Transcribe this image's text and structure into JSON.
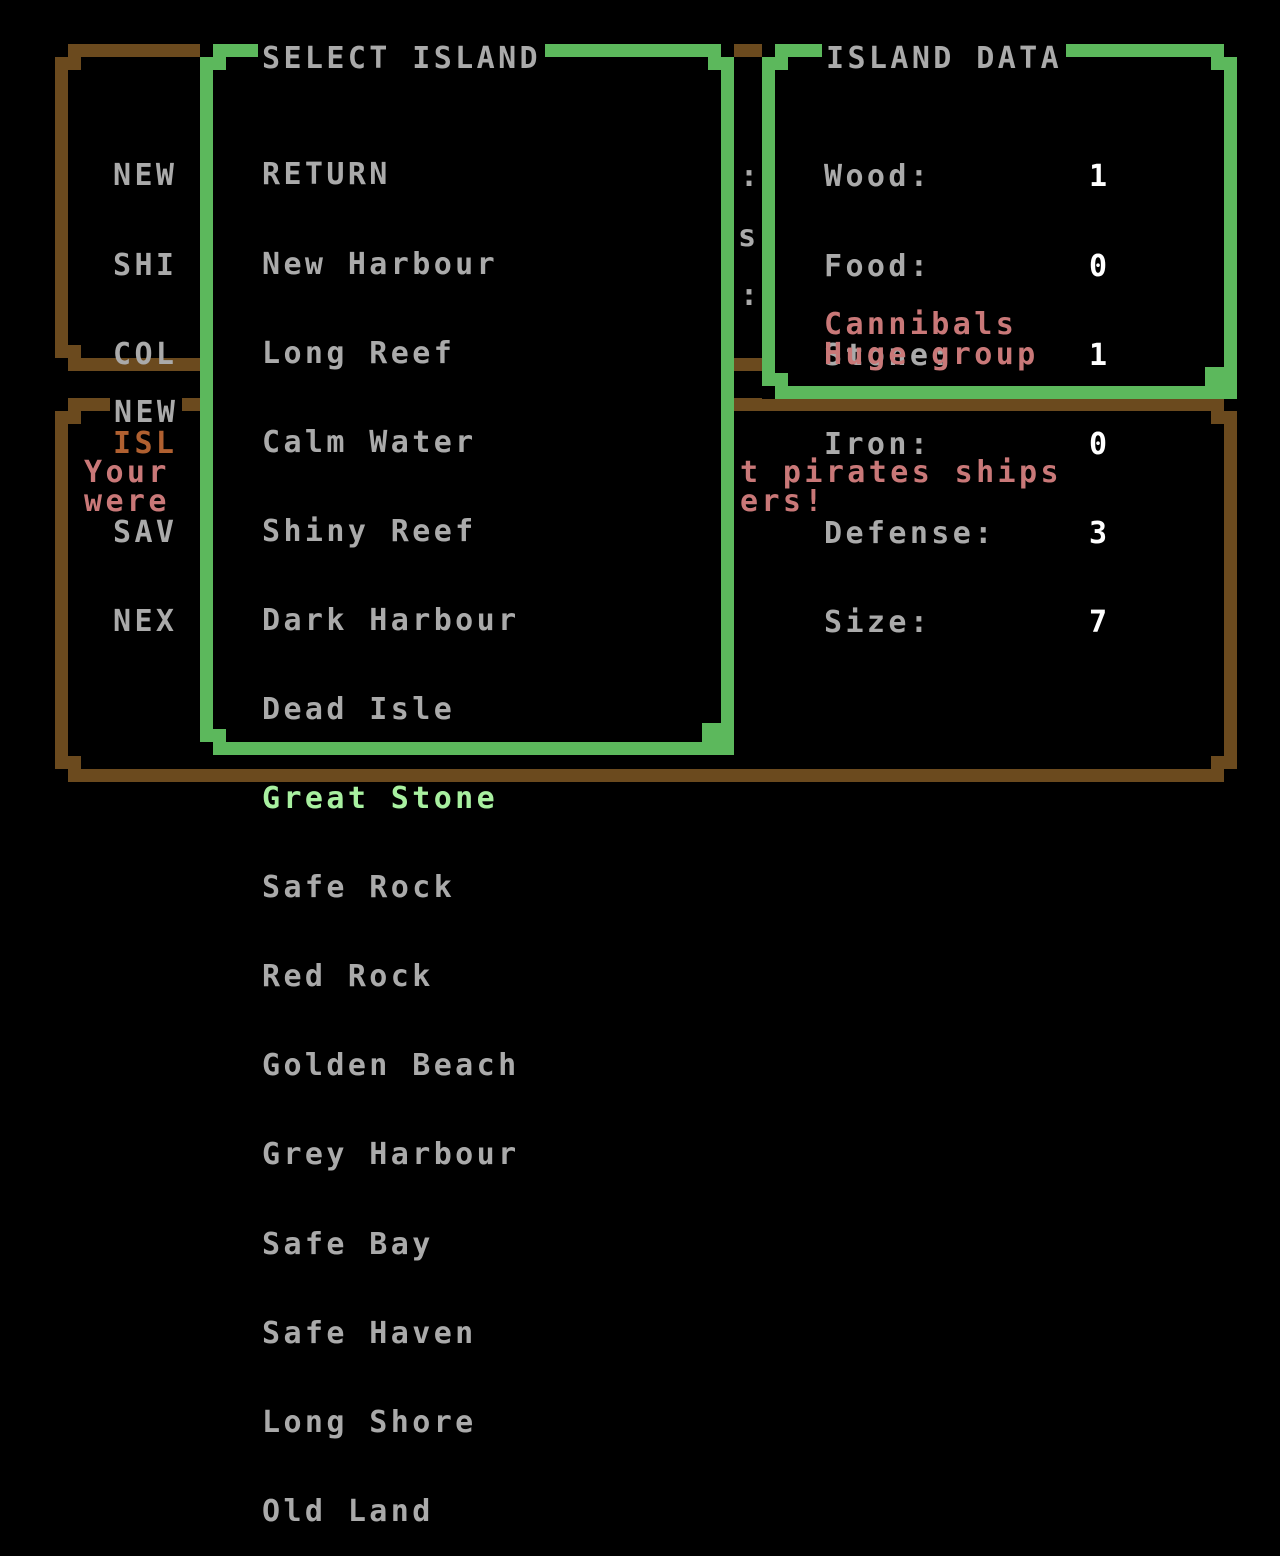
{
  "menu": {
    "items": [
      {
        "label": "NEW"
      },
      {
        "label": "SHI"
      },
      {
        "label": "COL"
      },
      {
        "label": "ISL"
      },
      {
        "label": "SAV"
      },
      {
        "label": "NEX"
      }
    ],
    "colon_fragments": [
      ":",
      "s",
      ":"
    ]
  },
  "news": {
    "title": "NEW",
    "line1_left": "Your",
    "line1_right": "t pirates ships",
    "line2_left": "were",
    "line2_right": "ers!"
  },
  "select_island": {
    "title": "SELECT ISLAND",
    "items": [
      {
        "label": "RETURN"
      },
      {
        "label": "New Harbour"
      },
      {
        "label": "Long Reef"
      },
      {
        "label": "Calm Water"
      },
      {
        "label": "Shiny Reef"
      },
      {
        "label": "Dark Harbour"
      },
      {
        "label": "Dead Isle"
      },
      {
        "label": "Great Stone"
      },
      {
        "label": "Safe Rock"
      },
      {
        "label": "Red Rock"
      },
      {
        "label": "Golden Beach"
      },
      {
        "label": "Grey Harbour"
      },
      {
        "label": "Safe Bay"
      },
      {
        "label": "Safe Haven"
      },
      {
        "label": "Long Shore"
      },
      {
        "label": "Old Land"
      }
    ],
    "selected_index": 7
  },
  "island_data": {
    "title": "ISLAND DATA",
    "stats": [
      {
        "label": "Wood:",
        "value": "1"
      },
      {
        "label": "Food:",
        "value": "0"
      },
      {
        "label": "Stone:",
        "value": "1"
      },
      {
        "label": "Iron:",
        "value": "0"
      },
      {
        "label": "Defense:",
        "value": "3"
      },
      {
        "label": "Size:",
        "value": "7"
      }
    ],
    "inhabitants": "Cannibals",
    "group_size": "Huge group"
  },
  "colors": {
    "brown": "#6b4a1e",
    "green": "#5cb85c",
    "grey_text": "#aaaaaa",
    "white_text": "#ffffff",
    "highlight_text": "#a8f0a0",
    "red_text": "#c97878",
    "orange_text": "#b06030"
  }
}
